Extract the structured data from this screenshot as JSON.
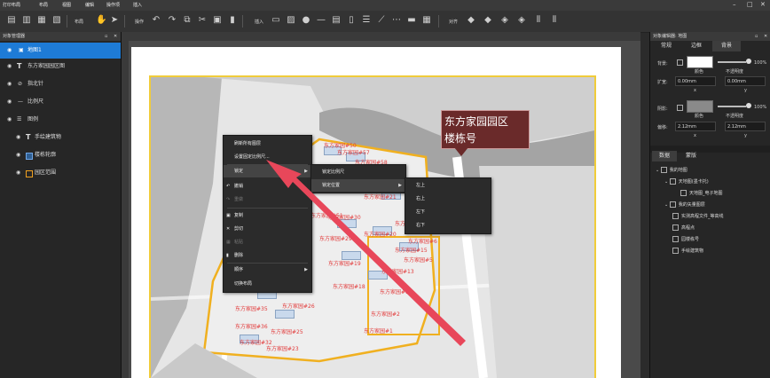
{
  "app": {
    "title": "打印布局",
    "menu": [
      "布局",
      "视图",
      "编辑",
      "操作项",
      "插入"
    ]
  },
  "toolbar": {
    "layout_label": "布局",
    "ops_label": "操作",
    "insert_label": "插入",
    "align_label": "对齐"
  },
  "layer_panel": {
    "title": "对象管理器",
    "items": [
      {
        "label": "地图1",
        "icon": "map-icon",
        "selected": true
      },
      {
        "label": "东方家园园区图",
        "icon": "text-icon"
      },
      {
        "label": "指北针",
        "icon": "compass-icon"
      },
      {
        "label": "比例尺",
        "icon": "scale-icon"
      },
      {
        "label": "图例",
        "icon": "legend-icon"
      },
      {
        "label": "手绘建筑物",
        "icon": "text-icon"
      },
      {
        "label": "楼栋轮廓",
        "icon": "polygon-icon"
      },
      {
        "label": "园区范围",
        "icon": "polygon-icon"
      }
    ]
  },
  "properties": {
    "title": "对象编辑器: 地图",
    "tabs": [
      "常规",
      "边框",
      "背景"
    ],
    "background_label": "背景:",
    "fill_label": "颜色",
    "opacity_value": "100%",
    "opacity_caption": "不透明度",
    "expand_label": "扩宽:",
    "expand_x": "0.00mm",
    "expand_y": "0.00mm",
    "x_caption": "x",
    "y_caption": "y",
    "shadow_label": "阴影:",
    "shadow_opacity": "100%",
    "offset_label": "偏移:",
    "offset_x": "2.12mm",
    "offset_y": "2.12mm",
    "data_tabs": [
      "数据",
      "蒙版"
    ],
    "tree": [
      {
        "label": "我的地图",
        "level": 0
      },
      {
        "label": "天地图(墨卡托)",
        "level": 1
      },
      {
        "label": "天地图_电子地图",
        "level": 2
      },
      {
        "label": "我的矢量图层",
        "level": 1
      },
      {
        "label": "实测高程文件_等高线",
        "level": 2
      },
      {
        "label": "高程点",
        "level": 2
      },
      {
        "label": "园楼栋号",
        "level": 2
      },
      {
        "label": "手绘建筑物",
        "level": 2
      }
    ]
  },
  "map": {
    "callout_line1": "东方家园园区",
    "callout_line2": "楼栋号",
    "labels": [
      "东方家园#50",
      "东方家园#57",
      "东方家园#58",
      "东方家园#21",
      "东方家园#51",
      "东方家园#30",
      "东方家园#29",
      "东方家园#20",
      "东方家园#15",
      "东方家园#19",
      "东方家园#13",
      "东方家园#18",
      "东方家园#12",
      "东方家园#26",
      "东方家园#35",
      "东方家园#2",
      "东方家园#36",
      "东方家园#25",
      "东方家园#1",
      "东方家园#32",
      "东方家园#23",
      "东方家园#10",
      "东方家园#5",
      "东方家园#6"
    ]
  },
  "context_menu": {
    "items": [
      {
        "label": "刷新所有图层",
        "disabled": false
      },
      {
        "label": "设置固定比例尺...",
        "disabled": false
      },
      {
        "label": "锁定",
        "disabled": false,
        "submenu": true,
        "highlighted": true
      },
      {
        "label": "撤销",
        "disabled": false
      },
      {
        "label": "重做",
        "disabled": true
      },
      {
        "label": "复制",
        "disabled": false
      },
      {
        "label": "剪切",
        "disabled": false
      },
      {
        "label": "粘贴",
        "disabled": true
      },
      {
        "label": "删除",
        "disabled": false
      },
      {
        "label": "顺序",
        "disabled": false,
        "submenu": true
      },
      {
        "label": "切换布局",
        "disabled": false
      }
    ],
    "lock_submenu": [
      "锁定比例尺",
      "锁定位置"
    ],
    "position_submenu": [
      "左上",
      "右上",
      "左下",
      "右下"
    ]
  },
  "annotation_color": "#e8475a",
  "accent_color": "#1e7bd6"
}
